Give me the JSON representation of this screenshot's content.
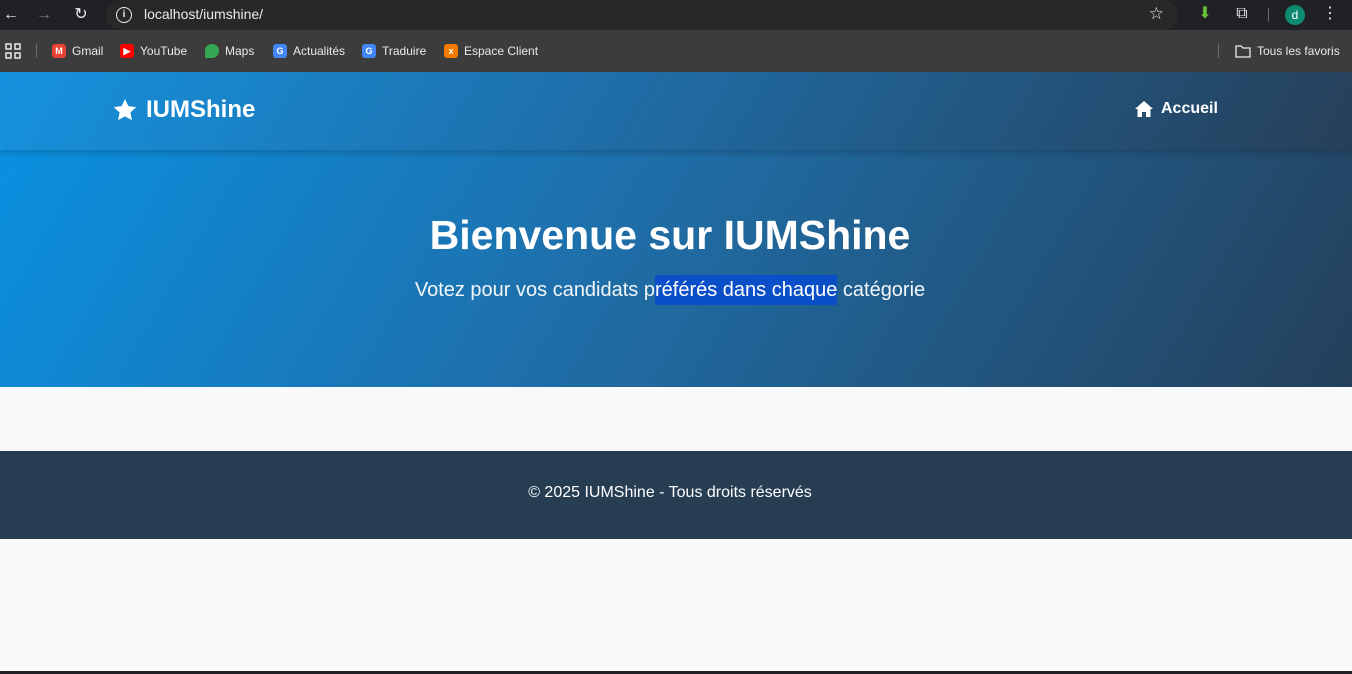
{
  "browser": {
    "url": "localhost/iumshine/",
    "avatar_letter": "d",
    "bookmarks": [
      {
        "label": "Gmail",
        "icon": "gmail-icon",
        "color": "#ea4335"
      },
      {
        "label": "YouTube",
        "icon": "youtube-icon",
        "color": "#ff0000"
      },
      {
        "label": "Maps",
        "icon": "maps-icon",
        "color": "#34a853"
      },
      {
        "label": "Actualités",
        "icon": "news-icon",
        "color": "#4285f4"
      },
      {
        "label": "Traduire",
        "icon": "translate-icon",
        "color": "#4285f4"
      },
      {
        "label": "Espace Client",
        "icon": "xampp-icon",
        "color": "#f57c00"
      }
    ],
    "all_bookmarks_label": "Tous les favoris"
  },
  "site": {
    "brand": "IUMShine",
    "nav_home": "Accueil",
    "hero": {
      "title": "Bienvenue sur IUMShine",
      "subtitle_before": "Votez pour vos candidats p",
      "subtitle_selected": "référés dans chaque",
      "subtitle_after": " catégorie"
    },
    "footer_text": "© 2025 IUMShine - Tous droits réservés"
  },
  "colors": {
    "header_gradient_start": "#1592de",
    "header_gradient_end": "#263f58",
    "footer_bg": "#263d52",
    "page_bg": "#f8f9fa",
    "selection": "#0b4fc8"
  }
}
